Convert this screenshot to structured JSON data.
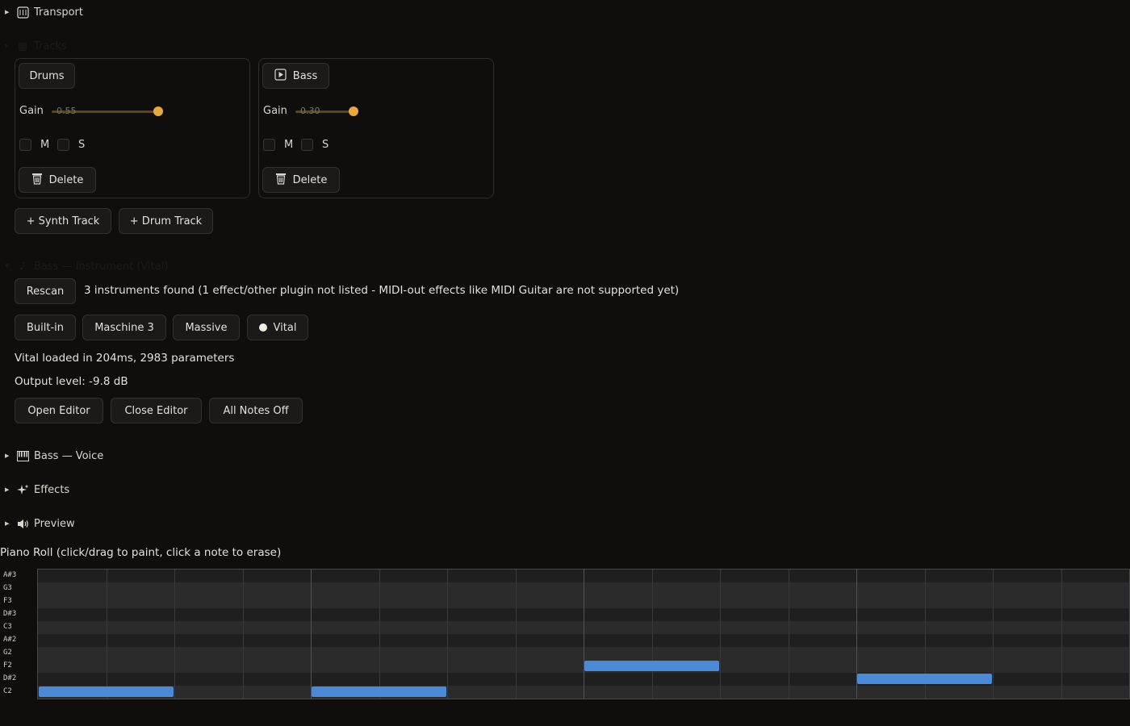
{
  "sections": {
    "transport": "Transport",
    "tracks_faded": "Tracks",
    "instrument_faded": "Bass — Instrument (Vital)",
    "voice": "Bass — Voice",
    "effects": "Effects",
    "preview": "Preview"
  },
  "tracks": [
    {
      "name": "Drums",
      "gain_label": "Gain",
      "gain_value": "0.55",
      "gain": 0.55,
      "mute": "M",
      "solo": "S",
      "delete": "Delete",
      "playing": false
    },
    {
      "name": "Bass",
      "gain_label": "Gain",
      "gain_value": "0.30",
      "gain": 0.3,
      "mute": "M",
      "solo": "S",
      "delete": "Delete",
      "playing": true
    }
  ],
  "add_buttons": {
    "synth": "+ Synth Track",
    "drum": "+ Drum Track"
  },
  "instrument": {
    "rescan": "Rescan",
    "status": "3 instruments found (1 effect/other plugin not listed - MIDI-out effects like MIDI Guitar are not supported yet)",
    "options": [
      "Built-in",
      "Maschine 3",
      "Massive",
      "Vital"
    ],
    "selected": "Vital",
    "loaded": "Vital loaded in 204ms, 2983 parameters",
    "output_level": "Output level: -9.8 dB",
    "open_editor": "Open Editor",
    "close_editor": "Close Editor",
    "all_notes_off": "All Notes Off"
  },
  "piano_roll": {
    "title": "Piano Roll (click/drag to paint, click a note to erase)",
    "row_labels": [
      "A#3",
      "G3",
      "F3",
      "D#3",
      "C3",
      "A#2",
      "G2",
      "F2",
      "D#2",
      "C2"
    ],
    "notes": [
      {
        "pitch": "C2",
        "start_step": 0,
        "length_steps": 2
      },
      {
        "pitch": "C2",
        "start_step": 4,
        "length_steps": 2
      },
      {
        "pitch": "F2",
        "start_step": 8,
        "length_steps": 2
      },
      {
        "pitch": "D#2",
        "start_step": 12,
        "length_steps": 2
      }
    ],
    "steps": 16,
    "note_color": "#4a8ad8"
  },
  "colors": {
    "accent": "#e8a93a",
    "background": "#0f0e0d"
  }
}
